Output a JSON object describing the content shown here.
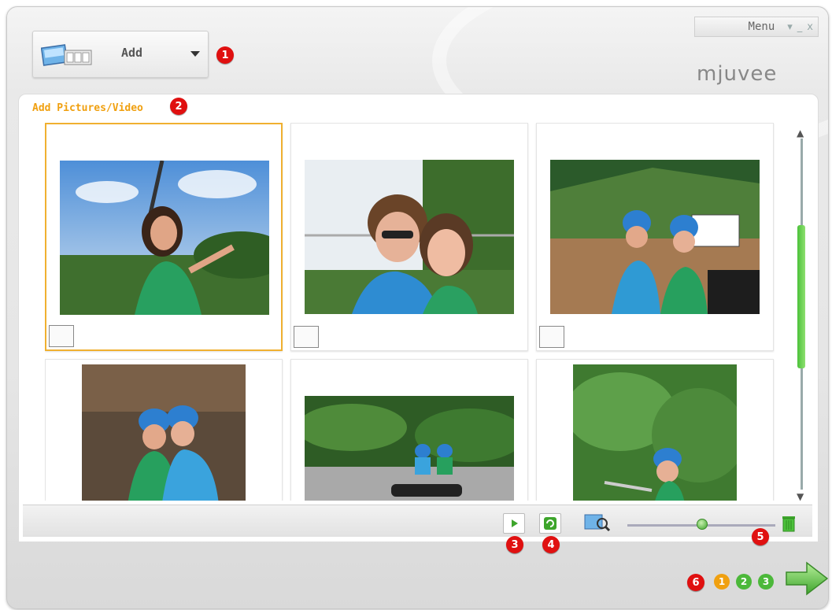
{
  "window": {
    "menu_label": "Menu",
    "minimize": "_",
    "close": "x",
    "logo": "mjuvee",
    "accent": "#f0a010"
  },
  "add_panel": {
    "label": "Add",
    "icon": "pictures-video-icon"
  },
  "section": {
    "title": "Add Pictures/Video"
  },
  "badges": [
    "1",
    "2",
    "3",
    "4",
    "5",
    "6"
  ],
  "media": [
    {
      "name": "photo-1",
      "selected": true,
      "type_icon": "picture-icon"
    },
    {
      "name": "photo-2",
      "selected": false,
      "type_icon": "picture-icon"
    },
    {
      "name": "photo-3",
      "selected": false,
      "type_icon": "picture-icon"
    },
    {
      "name": "photo-4",
      "selected": false,
      "type_icon": "picture-icon"
    },
    {
      "name": "photo-5",
      "selected": false,
      "type_icon": "picture-icon"
    },
    {
      "name": "photo-6",
      "selected": false,
      "type_icon": "picture-icon"
    }
  ],
  "toolbar": {
    "play_icon": "play-icon",
    "rotate_icon": "rotate-icon",
    "zoom_icon": "zoom-icon",
    "delete_icon": "trash-icon",
    "zoom_level": 0.5
  },
  "steps": [
    {
      "label": "1",
      "color": "#f0a010"
    },
    {
      "label": "2",
      "color": "#4cb83a"
    },
    {
      "label": "3",
      "color": "#4cb83a"
    }
  ],
  "next_icon": "next-arrow-icon"
}
